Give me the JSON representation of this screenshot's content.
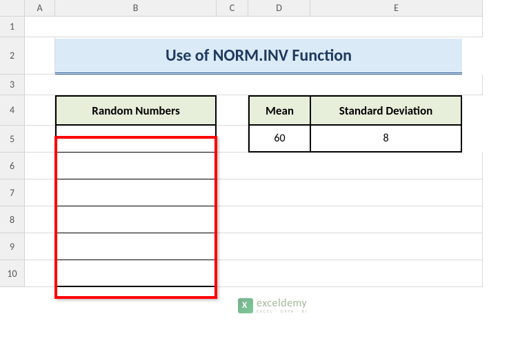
{
  "columns": [
    "A",
    "B",
    "C",
    "D",
    "E"
  ],
  "rows": [
    "1",
    "2",
    "3",
    "4",
    "5",
    "6",
    "7",
    "8",
    "9",
    "10"
  ],
  "title": "Use of NORM.INV Function",
  "headers": {
    "random": "Random Numbers",
    "mean": "Mean",
    "stddev": "Standard Deviation"
  },
  "values": {
    "mean": "60",
    "stddev": "8"
  },
  "random_values": [
    "",
    "",
    "",
    "",
    "",
    ""
  ],
  "watermark": {
    "main": "exceldemy",
    "sub": "EXCEL · DATA · BI"
  }
}
